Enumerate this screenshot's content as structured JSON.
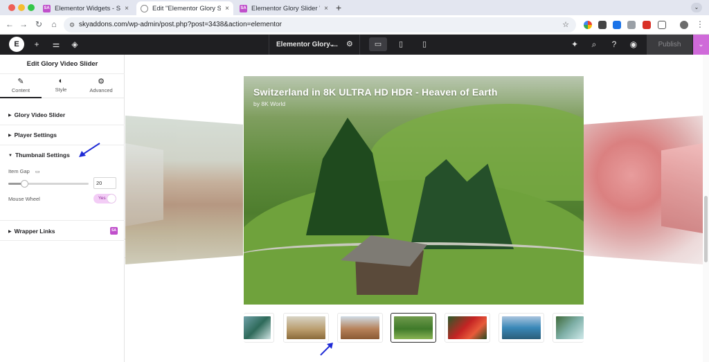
{
  "browser": {
    "tabs": [
      {
        "title": "Elementor Widgets - Sky Addo",
        "close": "×",
        "favicon_text": "SA",
        "favicon_color": "#c04fcb"
      },
      {
        "title": "Edit \"Elementor Glory Slider W",
        "close": "×",
        "favicon_text": "",
        "favicon_color": "#7a7a7a"
      },
      {
        "title": "Elementor Glory Slider Widge",
        "close": "×",
        "favicon_text": "SA",
        "favicon_color": "#c04fcb"
      }
    ],
    "new_tab": "+",
    "url": "skyaddons.com/wp-admin/post.php?post=3438&action=elementor"
  },
  "editor": {
    "document_name": "Elementor Glory ...",
    "publish_label": "Publish",
    "accent_color": "#cf6ad9"
  },
  "panel": {
    "title": "Edit Glory Video Slider",
    "tabs": [
      {
        "label": "Content",
        "icon": "pencil-icon"
      },
      {
        "label": "Style",
        "icon": "half-circle-icon"
      },
      {
        "label": "Advanced",
        "icon": "gear-icon"
      }
    ],
    "sections": {
      "glory": "Glory Video Slider",
      "player": "Player Settings",
      "thumbnail": "Thumbnail Settings",
      "wrapper": "Wrapper Links"
    },
    "item_gap_label": "Item Gap",
    "item_gap_value": "20",
    "item_gap_fraction": 0.2,
    "mouse_wheel_label": "Mouse Wheel",
    "mouse_wheel_toggle": "Yes",
    "badge_text": "SA"
  },
  "slider": {
    "title": "Switzerland in 8K ULTRA HD HDR - Heaven of Earth",
    "subtitle": "by 8K World",
    "thumbnails": [
      {
        "name": "waterfall",
        "active": false,
        "gradient": "linear-gradient(135deg,#6fa0a8,#2e6a5a 50%,#cfe3e3)"
      },
      {
        "name": "dry-hills",
        "active": false,
        "gradient": "linear-gradient(180deg,#d8d4c6,#b89a6a 60%,#8a6a3a)"
      },
      {
        "name": "horses",
        "active": false,
        "gradient": "linear-gradient(180deg,#cfdce6,#b7825a 55%,#8a5a34)"
      },
      {
        "name": "switzerland",
        "active": true,
        "gradient": "linear-gradient(180deg,#6f9a4c,#3f7a2a 55%,#8ab354)"
      },
      {
        "name": "parrot",
        "active": false,
        "gradient": "linear-gradient(135deg,#2a5a2a,#c42424 45%,#e85b3a 70%,#274a20)"
      },
      {
        "name": "lake",
        "active": false,
        "gradient": "linear-gradient(180deg,#a9c4de,#3a88b8 50%,#2b5e7a)"
      },
      {
        "name": "waterfall-2",
        "active": false,
        "gradient": "linear-gradient(135deg,#3f6a3a,#7fb0a8 50%,#cfe9ea)"
      }
    ]
  }
}
